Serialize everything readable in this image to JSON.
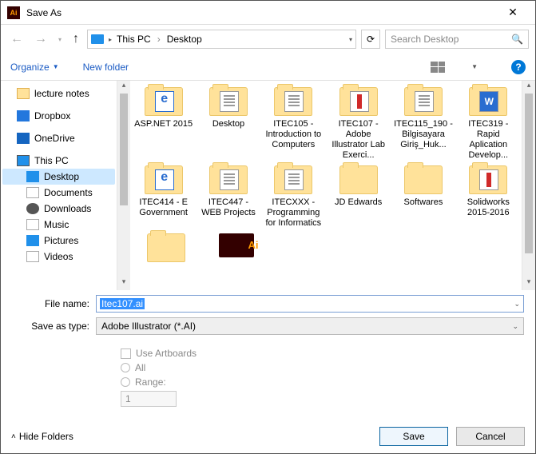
{
  "window": {
    "title": "Save As"
  },
  "nav": {
    "breadcrumb": {
      "root": "This PC",
      "current": "Desktop"
    },
    "search_placeholder": "Search Desktop"
  },
  "toolbar": {
    "organize": "Organize",
    "newfolder": "New folder"
  },
  "sidebar": {
    "items": [
      {
        "label": "lecture notes",
        "icon": "folder"
      },
      {
        "label": "Dropbox",
        "icon": "dropbox"
      },
      {
        "label": "OneDrive",
        "icon": "onedrive"
      },
      {
        "label": "This PC",
        "icon": "thispc"
      },
      {
        "label": "Desktop",
        "icon": "desktop",
        "selected": true
      },
      {
        "label": "Documents",
        "icon": "docs"
      },
      {
        "label": "Downloads",
        "icon": "downloads"
      },
      {
        "label": "Music",
        "icon": "music"
      },
      {
        "label": "Pictures",
        "icon": "pictures"
      },
      {
        "label": "Videos",
        "icon": "videos"
      }
    ]
  },
  "files": {
    "row1": [
      {
        "label": "ASP.NET 2015",
        "inner": "blue"
      },
      {
        "label": "Desktop",
        "inner": "text"
      },
      {
        "label": "ITEC105 - Introduction to Computers",
        "inner": "text"
      },
      {
        "label": "ITEC107 - Adobe Illustrator Lab Exerci...",
        "inner": "red"
      },
      {
        "label": "ITEC115_190 - Bilgisayara Giriş_Huk...",
        "inner": "text"
      },
      {
        "label": "ITEC319 - Rapid Aplication Develop...",
        "inner": "word"
      }
    ],
    "row2": [
      {
        "label": "ITEC414 - E Government",
        "inner": "blue"
      },
      {
        "label": "ITEC447 - WEB Projects",
        "inner": "text"
      },
      {
        "label": "ITECXXX - Programming for Informatics",
        "inner": "text"
      },
      {
        "label": "JD Edwards",
        "inner": ""
      },
      {
        "label": "Softwares",
        "inner": ""
      },
      {
        "label": "Solidworks 2015-2016",
        "inner": "red"
      }
    ],
    "row3": [
      {
        "label": "",
        "inner": "",
        "plain": true
      },
      {
        "label": "",
        "ai": true
      }
    ]
  },
  "form": {
    "filename_label": "File name:",
    "filename_value": "Itec107.ai",
    "type_label": "Save as type:",
    "type_value": "Adobe Illustrator (*.AI)",
    "use_artboards": "Use Artboards",
    "all": "All",
    "range": "Range:",
    "range_value": "1"
  },
  "footer": {
    "hide": "Hide Folders",
    "save": "Save",
    "cancel": "Cancel"
  }
}
